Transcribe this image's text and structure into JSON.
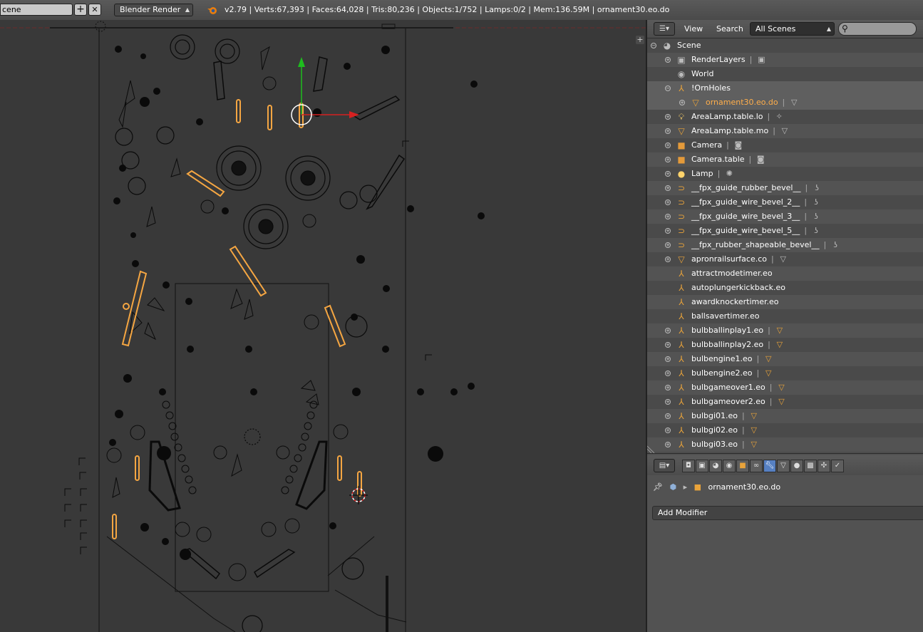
{
  "topbar": {
    "scene_name": "cene",
    "add_label": "+",
    "close_label": "✕",
    "engine": "Blender Render",
    "stats": "v2.79 | Verts:67,393 | Faces:64,028 | Tris:80,236 | Objects:1/752 | Lamps:0/2 | Mem:136.59M | ornament30.eo.do"
  },
  "outliner": {
    "menu_view": "View",
    "menu_search": "Search",
    "display_mode": "All Scenes",
    "rows": [
      {
        "label": "Scene",
        "icon": "scene-icon"
      },
      {
        "label": "RenderLayers",
        "icon": "renderlayers-icon"
      },
      {
        "label": "World",
        "icon": "world-icon"
      },
      {
        "label": "!OrnHoles",
        "icon": "empty-icon"
      },
      {
        "label": "ornament30.eo.do",
        "icon": "mesh-icon"
      },
      {
        "label": "AreaLamp.table.lo",
        "icon": "lamp-icon"
      },
      {
        "label": "AreaLamp.table.mo",
        "icon": "mesh-icon"
      },
      {
        "label": "Camera",
        "icon": "camera-icon"
      },
      {
        "label": "Camera.table",
        "icon": "camera-icon"
      },
      {
        "label": "Lamp",
        "icon": "lamp-icon"
      },
      {
        "label": "__fpx_guide_rubber_bevel__",
        "icon": "curve-icon"
      },
      {
        "label": "__fpx_guide_wire_bevel_2__",
        "icon": "curve-icon"
      },
      {
        "label": "__fpx_guide_wire_bevel_3__",
        "icon": "curve-icon"
      },
      {
        "label": "__fpx_guide_wire_bevel_5__",
        "icon": "curve-icon"
      },
      {
        "label": "__fpx_rubber_shapeable_bevel__",
        "icon": "curve-icon"
      },
      {
        "label": "apronrailsurface.co",
        "icon": "mesh-icon"
      },
      {
        "label": "attractmodetimer.eo",
        "icon": "empty-icon"
      },
      {
        "label": "autoplungerkickback.eo",
        "icon": "empty-icon"
      },
      {
        "label": "awardknockertimer.eo",
        "icon": "empty-icon"
      },
      {
        "label": "ballsavertimer.eo",
        "icon": "empty-icon"
      },
      {
        "label": "bulbballinplay1.eo",
        "icon": "empty-icon"
      },
      {
        "label": "bulbballinplay2.eo",
        "icon": "empty-icon"
      },
      {
        "label": "bulbengine1.eo",
        "icon": "empty-icon"
      },
      {
        "label": "bulbengine2.eo",
        "icon": "empty-icon"
      },
      {
        "label": "bulbgameover1.eo",
        "icon": "empty-icon"
      },
      {
        "label": "bulbgameover2.eo",
        "icon": "empty-icon"
      },
      {
        "label": "bulbgi01.eo",
        "icon": "empty-icon"
      },
      {
        "label": "bulbgi02.eo",
        "icon": "empty-icon"
      },
      {
        "label": "bulbgi03.eo",
        "icon": "empty-icon"
      }
    ]
  },
  "properties": {
    "object_name": "ornament30.eo.do",
    "add_modifier": "Add Modifier"
  },
  "colors": {
    "selection": "#f5a642",
    "x_axis": "#d62121",
    "y_axis": "#1ebd1e",
    "wire": "#0a0a0a"
  }
}
